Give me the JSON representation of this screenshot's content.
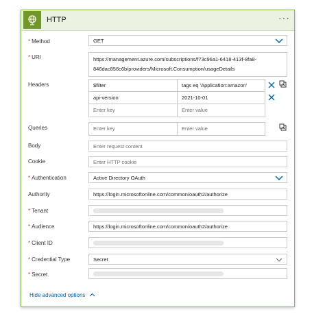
{
  "action": {
    "title": "HTTP",
    "more": "···"
  },
  "fields": {
    "method": {
      "label": "Method",
      "value": "GET"
    },
    "uri": {
      "label": "URI",
      "line1": "https://management.azure.com/subscriptions/f73c96a1-6418-413f-8fa8-",
      "line2": "846dac856c6b/providers/Microsoft.Consumption/usageDetails"
    },
    "headers": {
      "label": "Headers",
      "rows": [
        {
          "key": "$filter",
          "value": "tags eq 'Application:amazon'"
        },
        {
          "key": "api-version",
          "value": "2021-10-01"
        }
      ],
      "key_placeholder": "Enter key",
      "value_placeholder": "Enter value"
    },
    "queries": {
      "label": "Queries",
      "key_placeholder": "Enter key",
      "value_placeholder": "Enter value"
    },
    "body": {
      "label": "Body",
      "placeholder": "Enter request content"
    },
    "cookie": {
      "label": "Cookie",
      "placeholder": "Enter HTTP cookie"
    },
    "authentication": {
      "label": "Authentication",
      "value": "Active Directory OAuth"
    },
    "authority": {
      "label": "Authority",
      "value": "https://login.microsoftonline.com/common/oauth2/authorize"
    },
    "tenant": {
      "label": "Tenant"
    },
    "audience": {
      "label": "Audience",
      "value": "https://login.microsoftonline.com/common/oauth2/authorize"
    },
    "client_id": {
      "label": "Client ID"
    },
    "credential_type": {
      "label": "Credential Type",
      "value": "Secret"
    },
    "secret": {
      "label": "Secret"
    }
  },
  "advanced": {
    "label": "Hide advanced options"
  },
  "colors": {
    "accent": "#709727",
    "link": "#0062ad",
    "border": "#7fba56"
  }
}
